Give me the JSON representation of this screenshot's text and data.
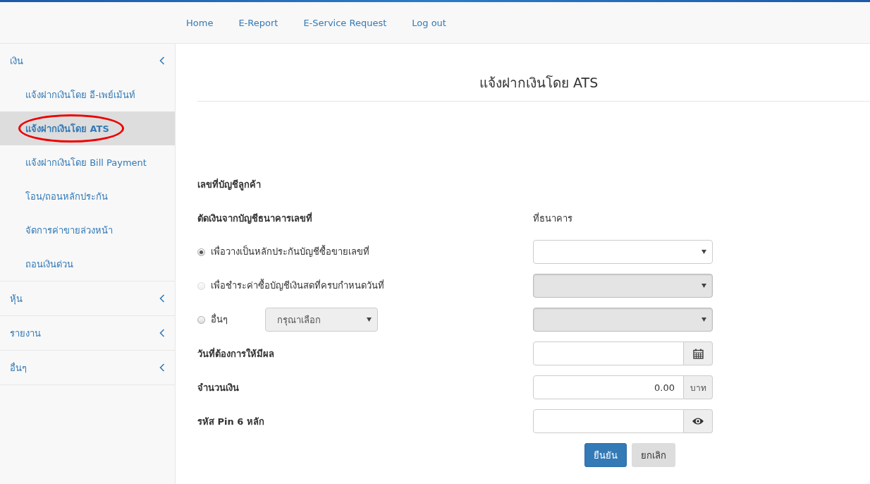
{
  "nav": {
    "links": [
      "Home",
      "E-Report",
      "E-Service Request",
      "Log out"
    ]
  },
  "sidebar": {
    "groups": [
      {
        "label": "เงิน",
        "items": [
          {
            "label": "แจ้งฝากเงินโดย อี-เพย์เม้นท์",
            "selected": false,
            "circled": false
          },
          {
            "label": "แจ้งฝากเงินโดย ATS",
            "selected": true,
            "circled": true
          },
          {
            "label": "แจ้งฝากเงินโดย Bill Payment",
            "selected": false,
            "circled": false
          },
          {
            "label": "โอน/ถอนหลักประกัน",
            "selected": false,
            "circled": false
          },
          {
            "label": "จัดการค่าขายล่วงหน้า",
            "selected": false,
            "circled": false
          },
          {
            "label": "ถอนเงินด่วน",
            "selected": false,
            "circled": false
          }
        ]
      },
      {
        "label": "หุ้น"
      },
      {
        "label": "รายงาน"
      },
      {
        "label": "อื่นๆ"
      }
    ]
  },
  "form": {
    "title": "แจ้งฝากเงินโดย ATS",
    "account_label": "เลขที่บัญชีลูกค้า",
    "debit_label": "ตัดเงินจากบัญชีธนาคารเลขที่",
    "bank_label": "ที่ธนาคาร",
    "options": [
      {
        "label": "เพื่อวางเป็นหลักประกันบัญชีซื้อขายเลขที่",
        "selected": true,
        "disabled": false,
        "bank_disabled": false
      },
      {
        "label": "เพื่อชำระค่าซื้อบัญชีเงินสดที่ครบกำหนดวันที่",
        "selected": false,
        "disabled": true,
        "bank_disabled": true
      },
      {
        "label": "อื่นๆ",
        "selected": false,
        "disabled": false,
        "bank_disabled": true,
        "select": {
          "placeholder": "กรุณาเลือก"
        }
      }
    ],
    "fields": [
      {
        "kind": "date",
        "label": "วันที่ต้องการให้มีผล"
      },
      {
        "kind": "amount",
        "label": "จำนวนเงิน",
        "value": "0.00",
        "unit": "บาท"
      },
      {
        "kind": "pin",
        "label": "รหัส Pin 6 หลัก"
      }
    ],
    "buttons": [
      {
        "kind": "primary",
        "label": "ยืนยัน"
      },
      {
        "kind": "default",
        "label": "ยกเลิก"
      }
    ]
  }
}
